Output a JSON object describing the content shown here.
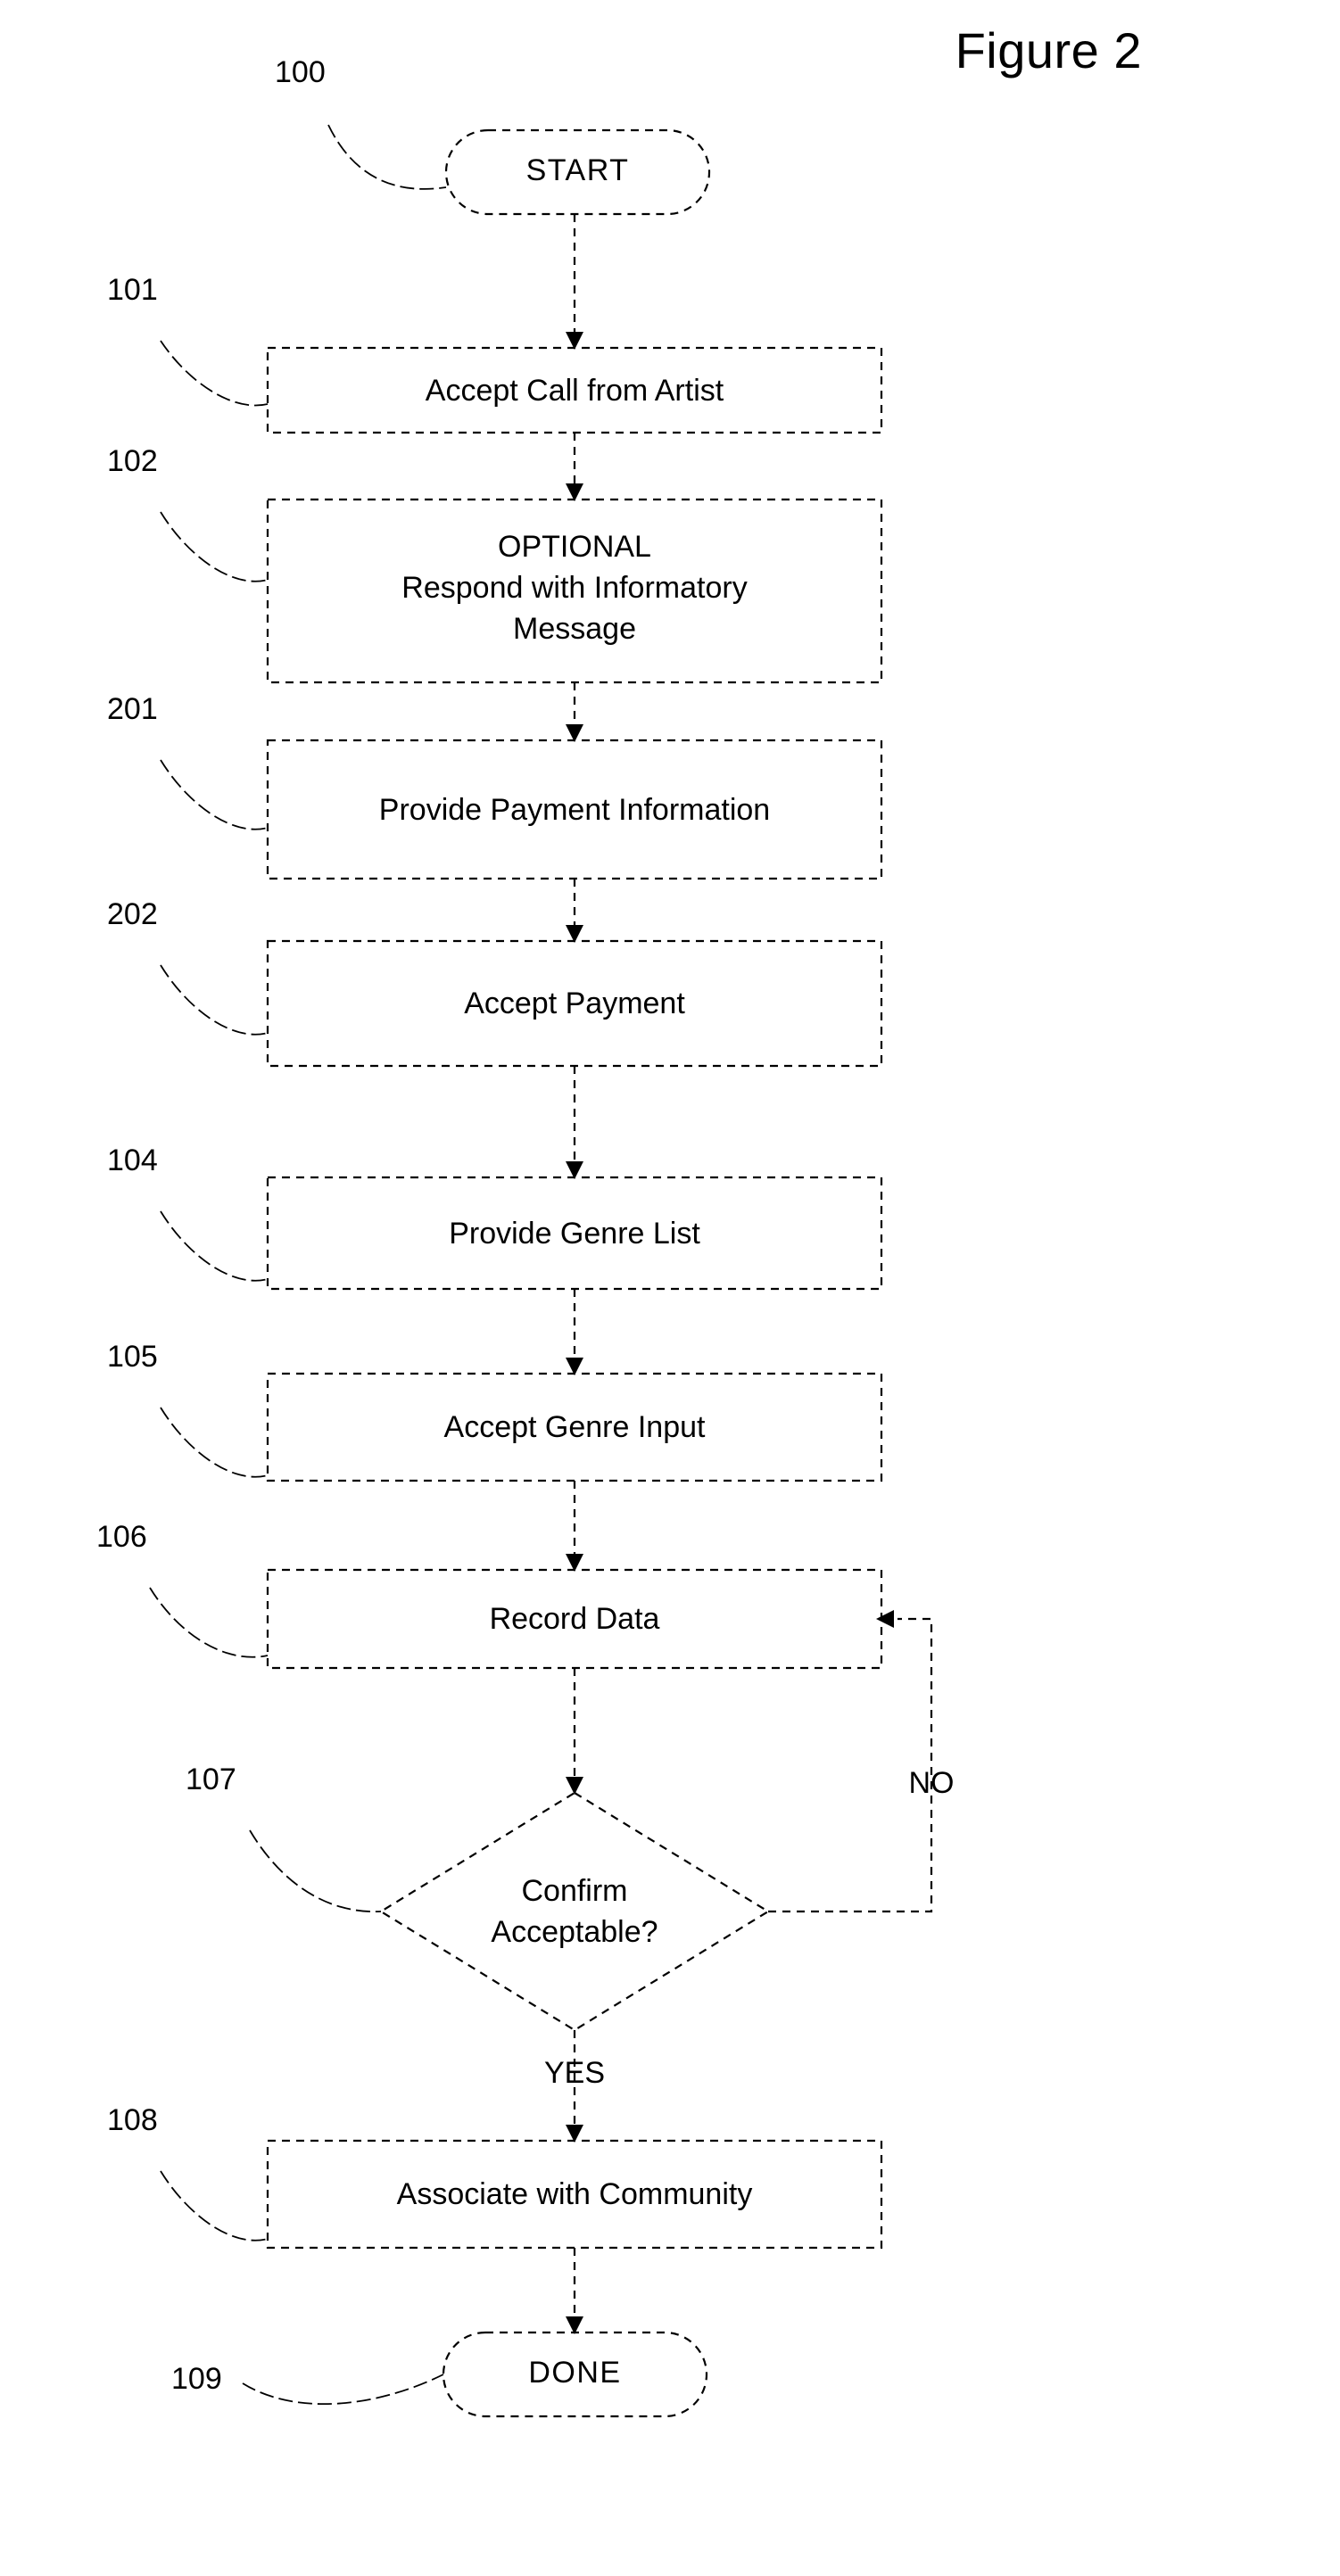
{
  "figure": {
    "title": "Figure 2",
    "type": "flowchart",
    "background": "#ffffff",
    "line_color": "#000000",
    "text_color": "#000000"
  },
  "nodes": [
    {
      "id": "start",
      "ref": "100",
      "shape": "terminal",
      "label": "START"
    },
    {
      "id": "n101",
      "ref": "101",
      "shape": "process",
      "label": "Accept Call from Artist"
    },
    {
      "id": "n102",
      "ref": "102",
      "shape": "process",
      "label": "OPTIONAL\nRespond with Informatory\nMessage"
    },
    {
      "id": "n201",
      "ref": "201",
      "shape": "process",
      "label": "Provide Payment Information"
    },
    {
      "id": "n202",
      "ref": "202",
      "shape": "process",
      "label": "Accept Payment"
    },
    {
      "id": "n104",
      "ref": "104",
      "shape": "process",
      "label": "Provide Genre List"
    },
    {
      "id": "n105",
      "ref": "105",
      "shape": "process",
      "label": "Accept Genre Input"
    },
    {
      "id": "n106",
      "ref": "106",
      "shape": "process",
      "label": "Record Data"
    },
    {
      "id": "n107",
      "ref": "107",
      "shape": "decision",
      "label": "Confirm\nAcceptable?"
    },
    {
      "id": "n108",
      "ref": "108",
      "shape": "process",
      "label": "Associate with Community"
    },
    {
      "id": "done",
      "ref": "109",
      "shape": "terminal",
      "label": "DONE"
    }
  ],
  "edge_labels": {
    "no": "NO",
    "yes": "YES"
  }
}
